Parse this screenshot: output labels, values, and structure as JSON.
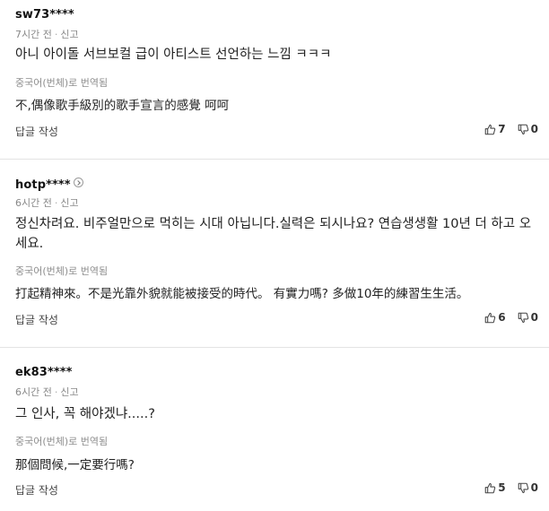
{
  "comments": [
    {
      "username": "sw73****",
      "time": "7시간 전",
      "report": "신고",
      "text": "아니 아이돌 서브보컬 급이 아티스트 선언하는 느낌 ㅋㅋㅋ",
      "translated_label": "중국어(번체)로 번역됨",
      "translated_text": "不,偶像歌手級別的歌手宣言的感覺 呵呵",
      "reply_label": "답글 작성",
      "likes": "7",
      "dislikes": "0"
    },
    {
      "username": "hotp****",
      "time": "6시간 전",
      "report": "신고",
      "text": "정신차려요. 비주얼만으로 먹히는 시대 아닙니다.실력은 되시나요? 연습생생활 10년 더 하고 오세요.",
      "translated_label": "중국어(번체)로 번역됨",
      "translated_text": "打起精神來。不是光靠外貌就能被接受的時代。 有實力嗎? 多做10年的練習生生活。",
      "reply_label": "답글 작성",
      "likes": "6",
      "dislikes": "0"
    },
    {
      "username": "ek83****",
      "time": "6시간 전",
      "report": "신고",
      "text": "그 인사, 꼭 해야겠냐.....?",
      "translated_label": "중국어(번체)로 번역됨",
      "translated_text": "那個問候,一定要行嗎?",
      "reply_label": "답글 작성",
      "likes": "5",
      "dislikes": "0"
    }
  ]
}
